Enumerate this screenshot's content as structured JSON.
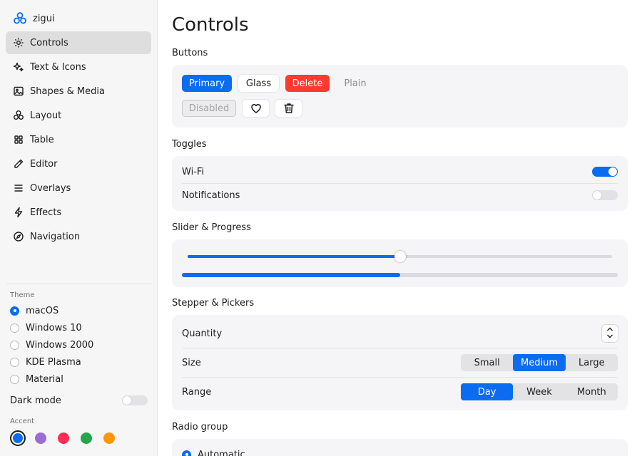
{
  "app": {
    "title": "zigui"
  },
  "sidebar": {
    "items": [
      {
        "label": "Controls",
        "icon": "gear-icon",
        "active": true
      },
      {
        "label": "Text & Icons",
        "icon": "sparkle-icon",
        "active": false
      },
      {
        "label": "Shapes & Media",
        "icon": "image-icon",
        "active": false
      },
      {
        "label": "Layout",
        "icon": "layout-icon",
        "active": false
      },
      {
        "label": "Table",
        "icon": "table-icon",
        "active": false
      },
      {
        "label": "Editor",
        "icon": "pencil-icon",
        "active": false
      },
      {
        "label": "Overlays",
        "icon": "list-icon",
        "active": false
      },
      {
        "label": "Effects",
        "icon": "bolt-icon",
        "active": false
      },
      {
        "label": "Navigation",
        "icon": "navigation-icon",
        "active": false
      }
    ],
    "theme_label": "Theme",
    "themes": [
      {
        "label": "macOS",
        "selected": true
      },
      {
        "label": "Windows 10",
        "selected": false
      },
      {
        "label": "Windows 2000",
        "selected": false
      },
      {
        "label": "KDE Plasma",
        "selected": false
      },
      {
        "label": "Material",
        "selected": false
      }
    ],
    "dark_mode_label": "Dark mode",
    "dark_mode_on": false,
    "accent_label": "Accent",
    "accent_colors": [
      "#0a6cf0",
      "#9b6bd6",
      "#ff2d55",
      "#20a84a",
      "#ff9500"
    ],
    "accent_selected_index": 0
  },
  "main": {
    "title": "Controls",
    "buttons": {
      "label": "Buttons",
      "primary": "Primary",
      "glass": "Glass",
      "delete": "Delete",
      "plain": "Plain",
      "disabled": "Disabled"
    },
    "toggles": {
      "label": "Toggles",
      "items": [
        {
          "label": "Wi-Fi",
          "on": true
        },
        {
          "label": "Notifications",
          "on": false
        }
      ]
    },
    "slider_progress": {
      "label": "Slider & Progress",
      "slider_value": 0.5,
      "progress_value": 0.5
    },
    "stepper_pickers": {
      "label": "Stepper & Pickers",
      "quantity_label": "Quantity",
      "size_label": "Size",
      "size_options": [
        "Small",
        "Medium",
        "Large"
      ],
      "size_selected": 1,
      "range_label": "Range",
      "range_options": [
        "Day",
        "Week",
        "Month"
      ],
      "range_selected": 0
    },
    "radio_group": {
      "label": "Radio group",
      "first_option": "Automatic"
    }
  },
  "colors": {
    "accent": "#0a6cf0",
    "danger": "#ff3b30",
    "card_bg": "#f5f5f7",
    "sidebar_bg": "#f6f6f6"
  }
}
